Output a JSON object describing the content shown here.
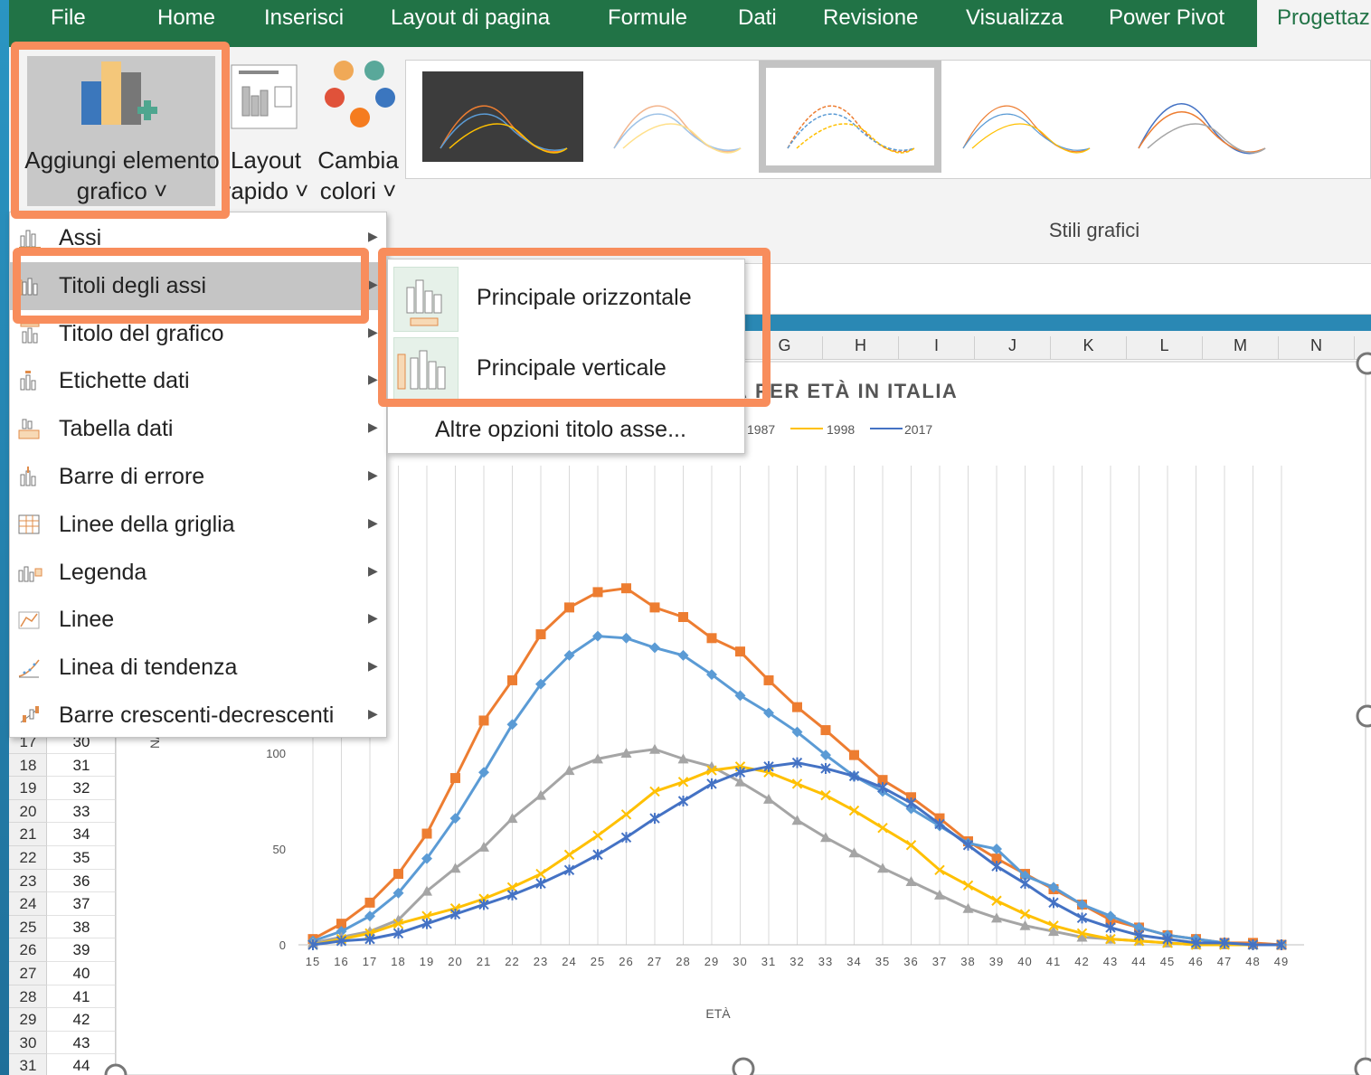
{
  "ribbon": {
    "tabs": [
      "File",
      "Home",
      "Inserisci",
      "Layout di pagina",
      "Formule",
      "Dati",
      "Revisione",
      "Visualizza",
      "Power Pivot",
      "Progettaz"
    ],
    "active_tab": "Progettaz",
    "add_element_line1": "Aggiungi elemento",
    "add_element_line2": "grafico ˅",
    "quick_layout_line1": "Layout",
    "quick_layout_line2": "rapido ˅",
    "change_colors_line1": "Cambia",
    "change_colors_line2": "colori ˅",
    "styles_group_label": "Stili grafici"
  },
  "menu": {
    "items": [
      {
        "label": "Assi",
        "icon": "axes-icon"
      },
      {
        "label": "Titoli degli assi",
        "icon": "axis-titles-icon"
      },
      {
        "label": "Titolo del grafico",
        "icon": "chart-title-icon"
      },
      {
        "label": "Etichette dati",
        "icon": "data-labels-icon"
      },
      {
        "label": "Tabella dati",
        "icon": "data-table-icon"
      },
      {
        "label": "Barre di errore",
        "icon": "error-bars-icon"
      },
      {
        "label": "Linee della griglia",
        "icon": "gridlines-icon"
      },
      {
        "label": "Legenda",
        "icon": "legend-icon"
      },
      {
        "label": "Linee",
        "icon": "lines-icon"
      },
      {
        "label": "Linea di tendenza",
        "icon": "trendline-icon"
      },
      {
        "label": "Barre crescenti-decrescenti",
        "icon": "up-down-bars-icon"
      }
    ],
    "highlighted": "Titoli degli assi"
  },
  "submenu": {
    "primary_horizontal": "Principale orizzontale",
    "primary_vertical": "Principale verticale",
    "more_options": "Altre opzioni titolo asse..."
  },
  "columns": [
    "G",
    "H",
    "I",
    "J",
    "K",
    "L",
    "M",
    "N"
  ],
  "rows": {
    "numbers": [
      "17",
      "18",
      "19",
      "20",
      "21",
      "22",
      "23",
      "24",
      "25",
      "26",
      "27",
      "28",
      "29",
      "30",
      "31"
    ],
    "values": [
      "30",
      "31",
      "32",
      "33",
      "34",
      "35",
      "36",
      "37",
      "38",
      "39",
      "40",
      "41",
      "42",
      "43",
      "44"
    ]
  },
  "colors": {
    "accent_highlight": "#f88d5c",
    "excel_green": "#217346"
  },
  "chart_data": {
    "type": "line",
    "title": "À PER ETÀ IN ITALIA",
    "xlabel": "ETÀ",
    "ylabel_visible_fragment": "NA",
    "ylim": [
      0,
      200
    ],
    "grid": "vertical",
    "legend_placement": "top",
    "x": [
      15,
      16,
      17,
      18,
      19,
      20,
      21,
      22,
      23,
      24,
      25,
      26,
      27,
      28,
      29,
      30,
      31,
      32,
      33,
      34,
      35,
      36,
      37,
      38,
      39,
      40,
      41,
      42,
      43,
      44,
      45,
      46,
      47,
      48,
      49
    ],
    "y_ticks": [
      "0",
      "50",
      "100"
    ],
    "series": [
      {
        "name": "",
        "color": "#ed7d31",
        "marker": "square",
        "values": [
          3,
          11,
          22,
          37,
          58,
          87,
          117,
          138,
          162,
          176,
          184,
          186,
          176,
          171,
          160,
          153,
          138,
          124,
          112,
          99,
          86,
          77,
          66,
          54,
          45,
          37,
          29,
          21,
          13,
          9,
          5,
          3,
          1,
          1,
          0
        ]
      },
      {
        "name": "",
        "color": "#5b9bd5",
        "marker": "diamond",
        "values": [
          2,
          7,
          15,
          27,
          45,
          66,
          90,
          115,
          136,
          151,
          161,
          160,
          155,
          151,
          141,
          130,
          121,
          111,
          99,
          88,
          80,
          71,
          62,
          53,
          50,
          36,
          30,
          21,
          15,
          9,
          5,
          3,
          1,
          0,
          0
        ]
      },
      {
        "name": "1987",
        "color": "#a5a5a5",
        "marker": "triangle",
        "values": [
          1,
          4,
          7,
          13,
          28,
          40,
          51,
          66,
          78,
          91,
          97,
          100,
          102,
          97,
          93,
          85,
          76,
          65,
          56,
          48,
          40,
          33,
          26,
          19,
          14,
          10,
          7,
          4,
          3,
          2,
          1,
          0,
          0,
          0,
          0
        ]
      },
      {
        "name": "1998",
        "color": "#ffc000",
        "marker": "x",
        "values": [
          0,
          3,
          6,
          11,
          15,
          19,
          24,
          30,
          37,
          47,
          57,
          68,
          80,
          85,
          91,
          93,
          90,
          84,
          78,
          70,
          61,
          52,
          39,
          31,
          23,
          16,
          10,
          6,
          3,
          2,
          1,
          0,
          0,
          0,
          0
        ]
      },
      {
        "name": "2017",
        "color": "#4472c4",
        "marker": "star",
        "values": [
          0,
          2,
          3,
          6,
          11,
          16,
          21,
          26,
          32,
          39,
          47,
          56,
          66,
          75,
          84,
          90,
          93,
          95,
          92,
          88,
          82,
          74,
          63,
          52,
          41,
          32,
          22,
          14,
          9,
          5,
          3,
          1,
          1,
          0,
          0
        ]
      }
    ]
  }
}
